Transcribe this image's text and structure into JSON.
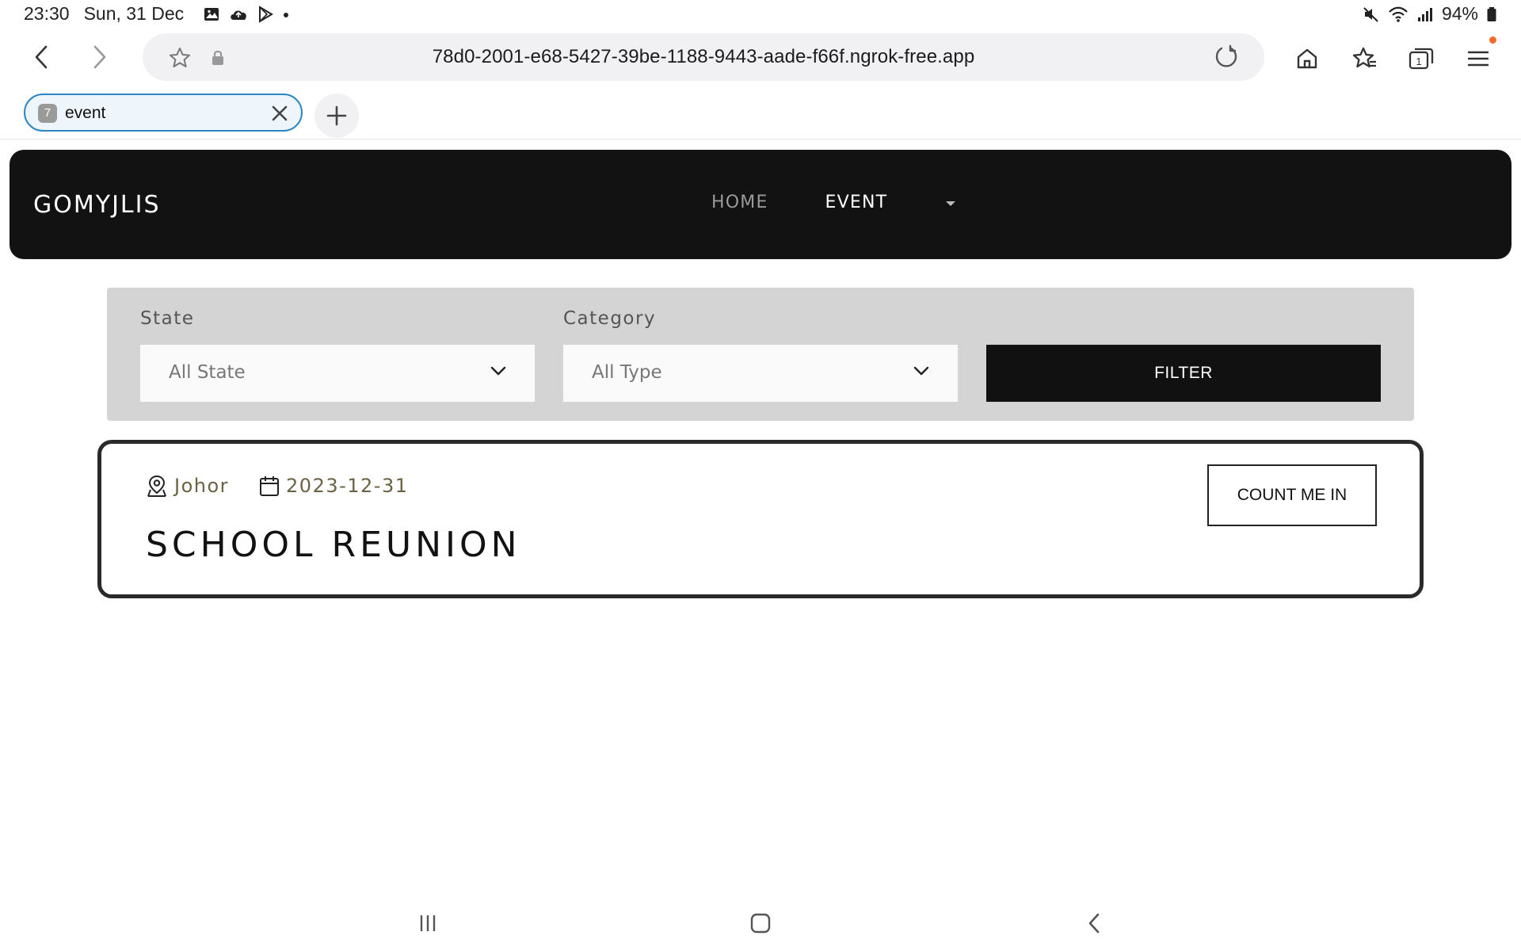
{
  "status_bar": {
    "time": "23:30",
    "date": "Sun, 31 Dec",
    "battery": "94%",
    "notification_icons": [
      "gallery-icon",
      "cloud-icon",
      "play-store-icon",
      "dot-icon"
    ],
    "system_icons": [
      "mute-icon",
      "wifi-icon",
      "signal-icon",
      "battery-icon"
    ]
  },
  "browser": {
    "url": "78d0-2001-e68-5427-39be-1188-9443-aade-f66f.ngrok-free.app",
    "tab_count": "7",
    "tab_title": "event",
    "accent_color": "#2b86c5",
    "notification_dot_color": "#f26b2a"
  },
  "site": {
    "brand": "GOMYJLIS",
    "nav": {
      "home": "HOME",
      "event": "EVENT"
    }
  },
  "filters": {
    "state_label": "State",
    "state_value": "All State",
    "category_label": "Category",
    "category_value": "All Type",
    "filter_button": "FILTER"
  },
  "events": [
    {
      "location": "Johor",
      "date": "2023-12-31",
      "title": "SCHOOL REUNION",
      "action": "COUNT ME IN"
    }
  ]
}
